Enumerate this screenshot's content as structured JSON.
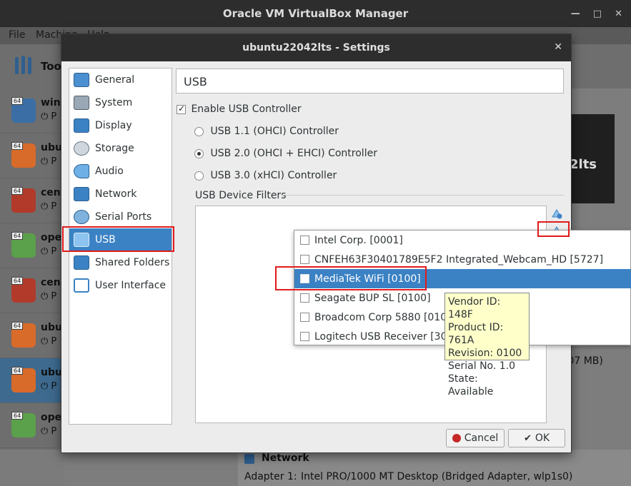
{
  "main_window": {
    "title": "Oracle VM VirtualBox Manager",
    "menu": [
      "File",
      "Machine",
      "Help"
    ],
    "tools_label": "Tool",
    "vms": [
      {
        "name": "win1",
        "state": "P",
        "badge": "64"
      },
      {
        "name": "ubur",
        "state": "P",
        "badge": "64"
      },
      {
        "name": "cent",
        "state": "P",
        "badge": "64"
      },
      {
        "name": "oper",
        "state": "P",
        "badge": "64"
      },
      {
        "name": "cent",
        "state": "P",
        "badge": "64"
      },
      {
        "name": "ubur",
        "state": "P",
        "badge": "64"
      },
      {
        "name": "ubur",
        "state": "P",
        "badge": "64"
      },
      {
        "name": "oper",
        "state": "P",
        "badge": "64"
      }
    ],
    "preview_text": "2lts",
    "size_text": ".07 MB)",
    "network_section": {
      "heading": "Network",
      "adapter_label": "Adapter 1:",
      "adapter_value": "Intel PRO/1000 MT Desktop (Bridged Adapter, wlp1s0)"
    }
  },
  "dialog": {
    "title": "ubuntu22042lts - Settings",
    "categories": [
      {
        "label": "General",
        "icon": "general-icon"
      },
      {
        "label": "System",
        "icon": "system-icon"
      },
      {
        "label": "Display",
        "icon": "display-icon"
      },
      {
        "label": "Storage",
        "icon": "storage-icon"
      },
      {
        "label": "Audio",
        "icon": "audio-icon"
      },
      {
        "label": "Network",
        "icon": "network-icon"
      },
      {
        "label": "Serial Ports",
        "icon": "serial-ports-icon"
      },
      {
        "label": "USB",
        "icon": "usb-icon"
      },
      {
        "label": "Shared Folders",
        "icon": "shared-folders-icon"
      },
      {
        "label": "User Interface",
        "icon": "user-interface-icon"
      }
    ],
    "selected_category": "USB",
    "page_title": "USB",
    "enable_usb_label": "Enable USB Controller",
    "enable_usb_checked": true,
    "controllers": [
      {
        "label": "USB 1.1 (OHCI) Controller",
        "selected": false
      },
      {
        "label": "USB 2.0 (OHCI + EHCI) Controller",
        "selected": true
      },
      {
        "label": "USB 3.0 (xHCI) Controller",
        "selected": false
      }
    ],
    "filters_label": "USB Device Filters",
    "cancel_label": "Cancel",
    "ok_label": "OK"
  },
  "device_menu": {
    "items": [
      {
        "label": "Intel Corp.  [0001]",
        "checked": false
      },
      {
        "label": "CNFEH63F30401789E5F2 Integrated_Webcam_HD [5727]",
        "checked": false
      },
      {
        "label": "MediaTek WiFi [0100]",
        "checked": false
      },
      {
        "label": "Seagate BUP SL [0100]",
        "checked": false
      },
      {
        "label": "Broadcom Corp 5880 [0101]",
        "checked": false
      },
      {
        "label": "Logitech USB Receiver [300",
        "checked": false
      }
    ],
    "selected_index": 2
  },
  "tooltip": {
    "lines": [
      "Vendor ID: 148F",
      "Product ID: 761A",
      "Revision: 0100",
      "Serial No. 1.0",
      "State: Available"
    ]
  },
  "colors": {
    "selection": "#3b82c4",
    "highlight_box": "#e11b1b",
    "tooltip_bg": "#ffffca",
    "titlebar": "#2d2d2d"
  }
}
